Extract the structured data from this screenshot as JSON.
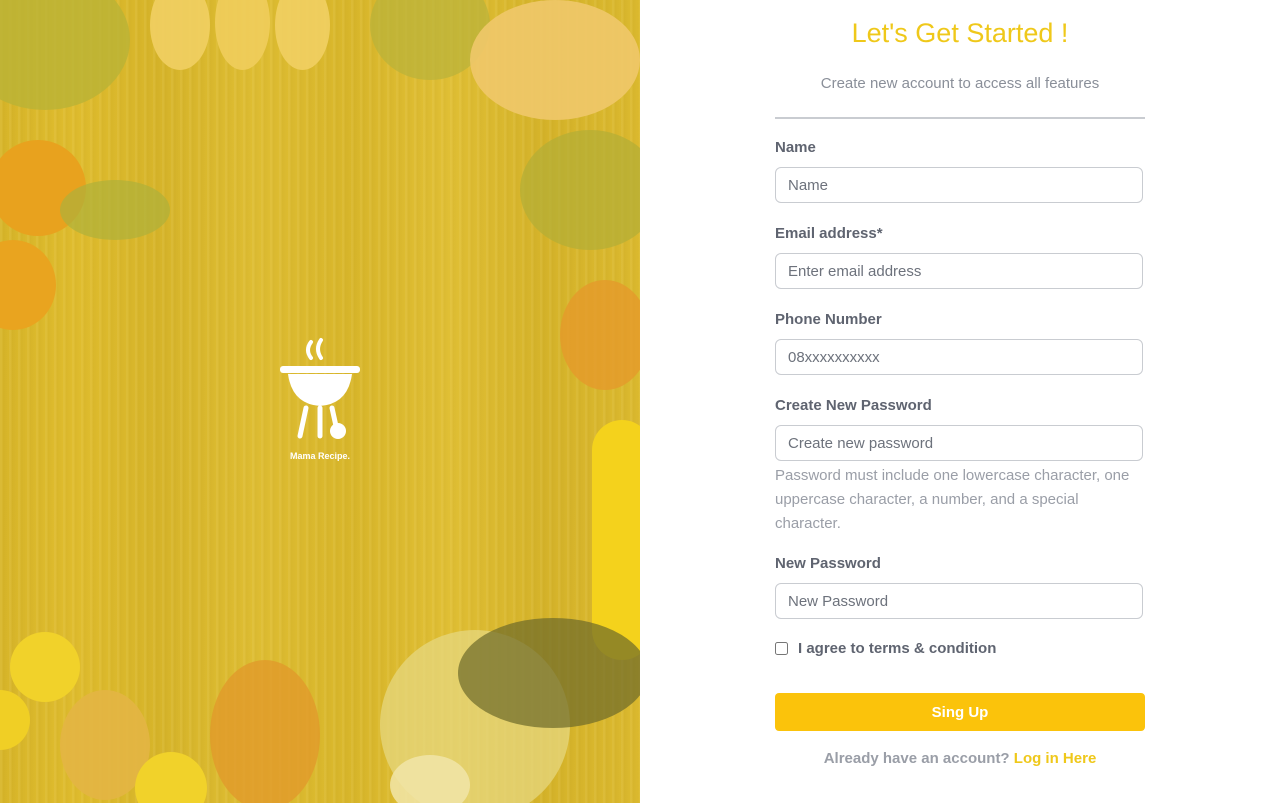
{
  "brand": {
    "name": "Mama Recipe.",
    "logo_icon": "grill-icon",
    "accent": "#efc81a",
    "button_color": "#fbc30b"
  },
  "header": {
    "title": "Let's Get Started !",
    "subtitle": "Create new account to access all features"
  },
  "form": {
    "name": {
      "label": "Name",
      "placeholder": "Name"
    },
    "email": {
      "label": "Email address*",
      "placeholder": "Enter email address"
    },
    "phone": {
      "label": "Phone Number",
      "placeholder": "08xxxxxxxxxx"
    },
    "create_password": {
      "label": "Create New Password",
      "placeholder": "Create new password",
      "hint": "Password must include one lowercase character, one uppercase character, a number, and a special character."
    },
    "new_password": {
      "label": "New Password",
      "placeholder": "New Password"
    },
    "terms_label": "I agree to terms & condition",
    "submit_label": "Sing Up"
  },
  "footer": {
    "prompt": "Already have an account?",
    "link": "Log in Here"
  }
}
